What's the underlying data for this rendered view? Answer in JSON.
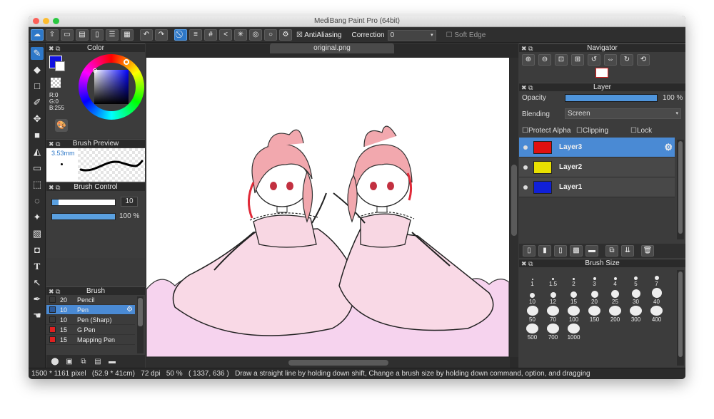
{
  "window": {
    "title": "MediBang Paint Pro (64bit)"
  },
  "toolbar": {
    "antialias_label": "AntiAliasing",
    "correction_label": "Correction",
    "correction_value": "0",
    "soft_edge_label": "Soft Edge"
  },
  "color_panel": {
    "title": "Color",
    "r": "R:0",
    "g": "G:0",
    "b": "B:255"
  },
  "brush_preview": {
    "title": "Brush Preview",
    "size": "3.53mm"
  },
  "brush_control": {
    "title": "Brush Control",
    "size_value": "10",
    "opacity_value": "100 %",
    "size_fraction": 0.1,
    "opacity_fraction": 1.0
  },
  "brush_panel": {
    "title": "Brush",
    "items": [
      {
        "size": "20",
        "name": "Pencil",
        "color": "#3a3a3a"
      },
      {
        "size": "10",
        "name": "Pen",
        "color": "#2d5a9a"
      },
      {
        "size": "10",
        "name": "Pen (Sharp)",
        "color": "#3a3a3a"
      },
      {
        "size": "15",
        "name": "G Pen",
        "color": "#e02020"
      },
      {
        "size": "15",
        "name": "Mapping Pen",
        "color": "#e02020"
      }
    ]
  },
  "canvas": {
    "tab": "original.png"
  },
  "navigator": {
    "title": "Navigator"
  },
  "layer_panel": {
    "title": "Layer",
    "opacity_label": "Opacity",
    "opacity_value": "100 %",
    "opacity_fraction": 1.0,
    "blending_label": "Blending",
    "blending_value": "Screen",
    "protect_alpha_label": "Protect Alpha",
    "clipping_label": "Clipping",
    "lock_label": "Lock",
    "layers": [
      {
        "name": "Layer3",
        "color": "#e01010"
      },
      {
        "name": "Layer2",
        "color": "#e8e000"
      },
      {
        "name": "Layer1",
        "color": "#1020d8"
      }
    ]
  },
  "brush_size_panel": {
    "title": "Brush Size",
    "sizes": [
      "1",
      "1.5",
      "2",
      "3",
      "4",
      "5",
      "7",
      "10",
      "12",
      "15",
      "20",
      "25",
      "30",
      "40",
      "50",
      "70",
      "100",
      "150",
      "200",
      "300",
      "400",
      "500",
      "700",
      "1000"
    ]
  },
  "status": {
    "dimensions": "1500 * 1161 pixel",
    "physical": "(52.9 * 41cm)",
    "dpi": "72 dpi",
    "zoom": "50 %",
    "coords": "( 1337, 636 )",
    "hint": "Draw a straight line by holding down shift, Change a brush size by holding down command, option, and dragging"
  },
  "colors": {
    "accent": "#4a8ad4",
    "panel_bg": "#3c3c3c",
    "dress_pink": "#f8d8e4",
    "hair_pink": "#f2a8ae"
  },
  "icons": [
    "brush-icon",
    "eraser-icon",
    "rect-icon",
    "fill-icon",
    "move-icon",
    "text-icon",
    "eyedropper-icon",
    "settings-gear-icon"
  ]
}
